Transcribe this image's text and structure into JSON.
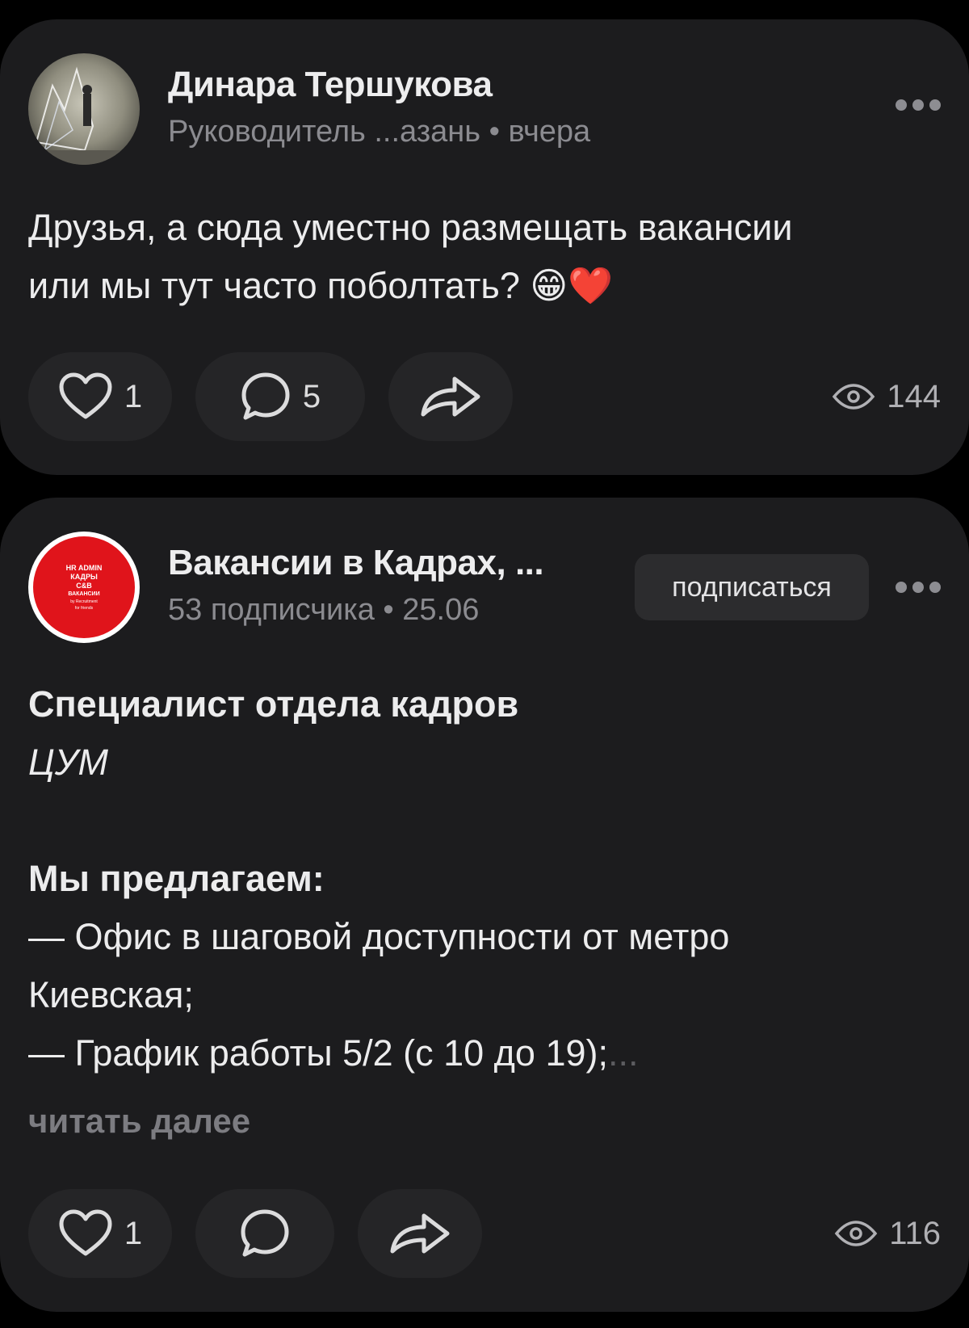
{
  "posts": [
    {
      "author": "Динара Тершукова",
      "meta": "Руководитель ...азань • вчера",
      "text_line1": "Друзья, а сюда уместно размещать вакансии",
      "text_line2": "или мы тут часто поболтать?",
      "emoji": "😁❤️",
      "likes": "1",
      "comments": "5",
      "views": "144"
    },
    {
      "author": "Вакансии в Кадрах, ...",
      "meta": "53 подписчика • 25.06",
      "subscribe_label": "подписаться",
      "avatar_text": [
        "HR ADMIN",
        "КАДРЫ",
        "C&B",
        "ВАКАНСИИ",
        "by Recruitment",
        "for friends"
      ],
      "title": "Специалист отдела кадров",
      "company": "ЦУМ",
      "offer_heading": "Мы предлагаем:",
      "offer_line1": "— Офис в шаговой доступности от метро",
      "offer_line2": "Киевская;",
      "offer_line3": "— График работы 5/2 (с 10 до 19);",
      "ellipsis": "...",
      "read_more": "читать далее",
      "likes": "1",
      "views": "116"
    }
  ],
  "colors": {
    "background": "#000000",
    "card": "#1c1c1e",
    "button": "#252527",
    "avatar_red": "#e0141b"
  },
  "icons": [
    "more-icon",
    "heart-icon",
    "comment-icon",
    "share-icon",
    "eye-icon"
  ]
}
